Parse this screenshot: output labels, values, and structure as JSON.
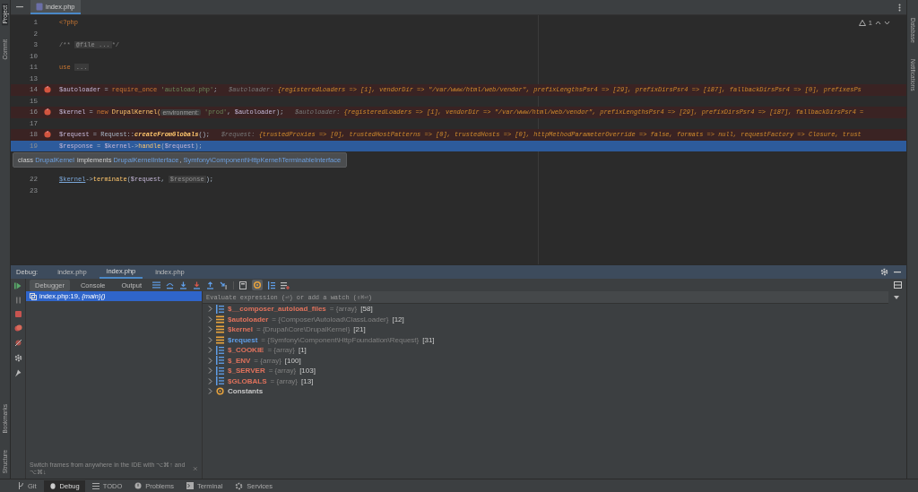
{
  "left_strip": {
    "top": [
      {
        "label": "Project",
        "selected": true
      },
      {
        "label": "Commit",
        "selected": false
      }
    ],
    "bottom": [
      {
        "label": "Bookmarks"
      },
      {
        "label": "Structure"
      }
    ]
  },
  "right_strip": [
    {
      "label": "Database"
    },
    {
      "label": "Notifications"
    }
  ],
  "editor": {
    "tabs": [
      {
        "label": "index.php",
        "selected": true
      }
    ],
    "warnings": "1",
    "lines": [
      {
        "number": "1",
        "kind": "normal",
        "tokens": [
          {
            "kind": "kw",
            "text": "<?php"
          }
        ]
      },
      {
        "number": "2",
        "kind": "normal"
      },
      {
        "number": "3",
        "kind": "normal",
        "tokens": [
          {
            "kind": "comment",
            "text": "/** "
          },
          {
            "kind": "fold",
            "text": "@file ..."
          },
          {
            "kind": "comment",
            "text": "*/"
          }
        ]
      },
      {
        "number": "10",
        "kind": "normal"
      },
      {
        "number": "11",
        "kind": "normal",
        "tokens": [
          {
            "kind": "kw",
            "text": "use "
          },
          {
            "kind": "fold",
            "text": "..."
          }
        ]
      },
      {
        "number": "13",
        "kind": "normal"
      },
      {
        "number": "14",
        "kind": "breakpoint",
        "tokens": [
          {
            "kind": "var",
            "text": "$autoloader"
          },
          {
            "kind": "plain",
            "text": " = "
          },
          {
            "kind": "kw",
            "text": "require_once "
          },
          {
            "kind": "str",
            "text": "'autoload.php'"
          },
          {
            "kind": "plain",
            "text": ";"
          },
          {
            "kind": "dbgname",
            "text": "   $autoloader: "
          },
          {
            "kind": "dbgval",
            "text": "{registeredLoaders => [1], vendorDir => \"/var/www/html/web/vendor\", prefixLengthsPsr4 => [29], prefixDirsPsr4 => [187], fallbackDirsPsr4 => [0], prefixesPs"
          }
        ]
      },
      {
        "number": "15",
        "kind": "normal"
      },
      {
        "number": "16",
        "kind": "breakpoint",
        "tokens": [
          {
            "kind": "var",
            "text": "$kernel"
          },
          {
            "kind": "plain",
            "text": " = "
          },
          {
            "kind": "kw",
            "text": "new "
          },
          {
            "kind": "fn",
            "text": "DrupalKernel("
          },
          {
            "kind": "hint",
            "text": "environment:"
          },
          {
            "kind": "str",
            "text": " 'prod'"
          },
          {
            "kind": "plain",
            "text": ", "
          },
          {
            "kind": "var",
            "text": "$autoloader"
          },
          {
            "kind": "plain",
            "text": ");"
          },
          {
            "kind": "dbgname",
            "text": "   $autoloader: "
          },
          {
            "kind": "dbgval",
            "text": "{registeredLoaders => [1], vendorDir => \"/var/www/html/web/vendor\", prefixLengthsPsr4 => [29], prefixDirsPsr4 => [187], fallbackDirsPsr4 ="
          }
        ]
      },
      {
        "number": "17",
        "kind": "normal"
      },
      {
        "number": "18",
        "kind": "breakpoint",
        "tokens": [
          {
            "kind": "var",
            "text": "$request"
          },
          {
            "kind": "plain",
            "text": " = Request::"
          },
          {
            "kind": "method",
            "text": "createFromGlobals"
          },
          {
            "kind": "plain",
            "text": "();"
          },
          {
            "kind": "dbgname",
            "text": "   $request: "
          },
          {
            "kind": "dbgval",
            "text": "{trustedProxies => [0], trustedHostPatterns => [0], trustedHosts => [0], httpMethodParameterOverride => false, formats => null, requestFactory => Closure, trust"
          }
        ]
      },
      {
        "number": "19",
        "kind": "current",
        "tokens": [
          {
            "kind": "var",
            "text": "$response"
          },
          {
            "kind": "plain",
            "text": " = "
          },
          {
            "kind": "var",
            "text": "$kernel"
          },
          {
            "kind": "plain",
            "text": "->"
          },
          {
            "kind": "fn",
            "text": "handle"
          },
          {
            "kind": "plain",
            "text": "("
          },
          {
            "kind": "var",
            "text": "$request"
          },
          {
            "kind": "plain",
            "text": ");"
          }
        ],
        "tooltip": [
          {
            "kind": "text",
            "text": "class "
          },
          {
            "kind": "link",
            "text": "DrupalKernel"
          },
          {
            "kind": "text",
            "text": " implements "
          },
          {
            "kind": "link",
            "text": "DrupalKernelInterface"
          },
          {
            "kind": "text",
            "text": ", "
          },
          {
            "kind": "link",
            "text": "Symfony\\Component\\HttpKernel\\TerminableInterface"
          }
        ]
      },
      {
        "number": "22",
        "kind": "normal",
        "tokens": [
          {
            "kind": "varlink",
            "text": "$kernel"
          },
          {
            "kind": "plain",
            "text": "->"
          },
          {
            "kind": "fn",
            "text": "terminate"
          },
          {
            "kind": "plain",
            "text": "("
          },
          {
            "kind": "var",
            "text": "$request"
          },
          {
            "kind": "plain",
            "text": ", "
          },
          {
            "kind": "fold",
            "text": "$response"
          },
          {
            "kind": "plain",
            "text": ");"
          }
        ]
      },
      {
        "number": "23",
        "kind": "normal"
      }
    ]
  },
  "debug": {
    "title": "Debug:",
    "sessions": [
      {
        "label": "index.php",
        "selected": false
      },
      {
        "label": "index.php",
        "selected": true
      },
      {
        "label": "index.php",
        "selected": false
      }
    ],
    "tabs": [
      {
        "label": "Debugger",
        "selected": true
      },
      {
        "label": "Console",
        "selected": false
      },
      {
        "label": "Output",
        "selected": false
      }
    ],
    "frames": [
      {
        "text": "index.php:19, *{main}()*",
        "selected": true
      }
    ],
    "frames_hint": "Switch frames from anywhere in the IDE with ⌥⌘↑ and ⌥⌘↓",
    "evaluate": {
      "placeholder": "Evaluate expression (⏎) or add a watch (⇧⌘⏎)"
    },
    "variables": [
      {
        "name": "$__composer_autoload_files",
        "type": "= {array}",
        "count": "[58]",
        "kind": "array",
        "color": "#e0725c"
      },
      {
        "name": "$autoloader",
        "type": "= {Composer\\Autoload\\ClassLoader}",
        "count": "[12]",
        "kind": "object",
        "color": "#e0725c"
      },
      {
        "name": "$kernel",
        "type": "= {Drupal\\Core\\DrupalKernel}",
        "count": "[21]",
        "kind": "object",
        "color": "#e0725c"
      },
      {
        "name": "$request",
        "type": "= {Symfony\\Component\\HttpFoundation\\Request}",
        "count": "[31]",
        "kind": "object",
        "color": "#5f9ee8"
      },
      {
        "name": "$_COOKIE",
        "type": "= {array}",
        "count": "[1]",
        "kind": "array",
        "color": "#e0725c"
      },
      {
        "name": "$_ENV",
        "type": "= {array}",
        "count": "[100]",
        "kind": "array",
        "color": "#e0725c"
      },
      {
        "name": "$_SERVER",
        "type": "= {array}",
        "count": "[103]",
        "kind": "array",
        "color": "#e0725c"
      },
      {
        "name": "$GLOBALS",
        "type": "= {array}",
        "count": "[13]",
        "kind": "array",
        "color": "#e0725c"
      },
      {
        "name": "Constants",
        "kind": "constants",
        "color": "#c8c8c8"
      }
    ]
  },
  "bottom_bar": [
    {
      "label": "Git",
      "kind": "git",
      "selected": false
    },
    {
      "label": "Debug",
      "kind": "debug",
      "selected": true
    },
    {
      "label": "TODO",
      "kind": "todo",
      "selected": false
    },
    {
      "label": "Problems",
      "kind": "problems",
      "selected": false
    },
    {
      "label": "Terminal",
      "kind": "terminal",
      "selected": false
    },
    {
      "label": "Services",
      "kind": "services",
      "selected": false
    }
  ]
}
